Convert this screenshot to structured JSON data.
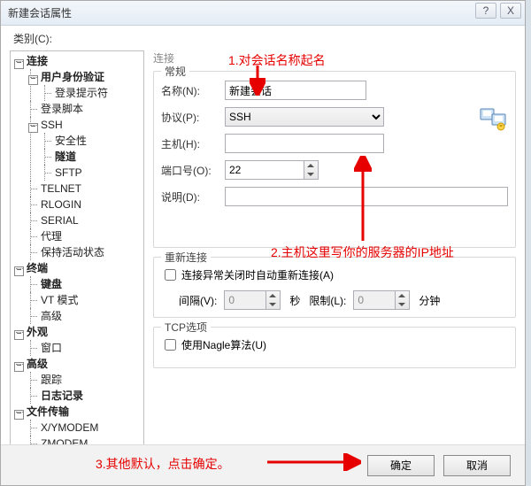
{
  "title": "新建会话属性",
  "category_label": "类别(C):",
  "tree": {
    "root": "连接",
    "auth": "用户身份验证",
    "login_prompt": "登录提示符",
    "login_script": "登录脚本",
    "ssh": "SSH",
    "security": "安全性",
    "tunnel": "隧道",
    "sftp": "SFTP",
    "telnet": "TELNET",
    "rlogin": "RLOGIN",
    "serial": "SERIAL",
    "proxy": "代理",
    "keepalive": "保持活动状态",
    "terminal": "终端",
    "keyboard": "键盘",
    "vt": "VT 模式",
    "advanced_term": "高级",
    "appearance": "外观",
    "window": "窗口",
    "advanced": "高级",
    "trace": "跟踪",
    "log": "日志记录",
    "filetransfer": "文件传输",
    "xymodem": "X/YMODEM",
    "zmodem": "ZMODEM"
  },
  "panel": {
    "title": "连接",
    "general_legend": "常规",
    "name_label": "名称(N):",
    "name_value": "新建会话",
    "protocol_label": "协议(P):",
    "protocol_value": "SSH",
    "host_label": "主机(H):",
    "host_value": "",
    "port_label": "端口号(O):",
    "port_value": "22",
    "desc_label": "说明(D):",
    "desc_value": "",
    "reconnect_legend": "重新连接",
    "reconnect_check": "连接异常关闭时自动重新连接(A)",
    "interval_label": "间隔(V):",
    "interval_value": "0",
    "sec_label": "秒",
    "limit_label": "限制(L):",
    "limit_value": "0",
    "min_label": "分钟",
    "tcp_legend": "TCP选项",
    "nagle_check": "使用Nagle算法(U)"
  },
  "footer": {
    "ok": "确定",
    "cancel": "取消"
  },
  "annotations": {
    "a1": "1.对会话名称起名",
    "a2": "2.主机这里写你的服务器的IP地址",
    "a3": "3.其他默认，点击确定。"
  }
}
